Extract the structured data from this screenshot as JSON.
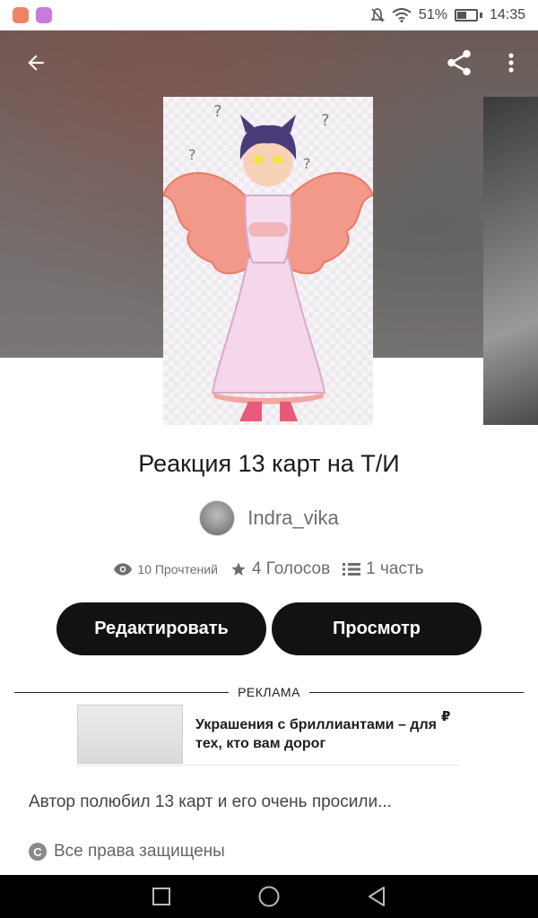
{
  "status_bar": {
    "battery": "51%",
    "time": "14:35"
  },
  "story": {
    "title": "Реакция 13 карт на Т/И",
    "author": "Indra_vika",
    "reads": "10 Прочтений",
    "votes": "4 Голосов",
    "parts": "1 часть",
    "description": "Автор полюбил 13 карт и его очень просили...",
    "copyright": "Все права защищены"
  },
  "actions": {
    "edit_label": "Редактировать",
    "view_label": "Просмотр"
  },
  "ad": {
    "label": "РЕКЛАМА",
    "text": "Украшения с бриллиантами – для тех, кто вам дорог",
    "currency": "₽"
  },
  "icons": {
    "back": "arrow-left-icon",
    "share": "share-icon",
    "menu": "more-vert-icon",
    "views": "eye-icon",
    "votes": "star-icon",
    "parts": "list-icon",
    "copyright": "copyright-icon"
  },
  "colors": {
    "button_bg": "#121212",
    "text_muted": "#6e6e6e"
  }
}
